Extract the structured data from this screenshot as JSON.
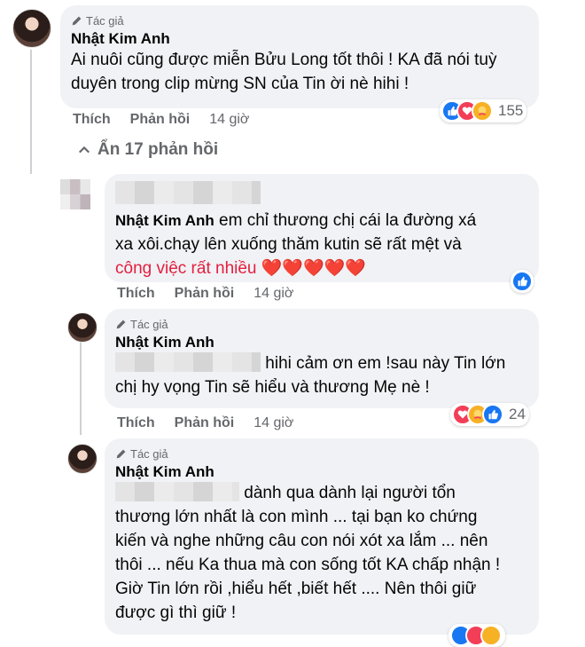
{
  "comment": {
    "author_tag": "Tác giả",
    "name": "Nhật Kim Anh",
    "text_line1": "Ai nuôi cũng được miễn Bửu Long tốt thôi ! KA đã nói tuỳ",
    "text_line2": "duyên trong clip mừng SN của Tin ời nè hihi !",
    "actions": {
      "like": "Thích",
      "reply": "Phản hồi",
      "time": "14 giờ"
    },
    "reaction_count": "155"
  },
  "hidden_replies": {
    "label": "Ẩn 17 phản hồi"
  },
  "reply1": {
    "name": "Nhật Kim Anh",
    "text_inline": "em chỉ thương chị cái la đường xá",
    "text_line2": "xa xôi.chạy lên xuống thăm kutin sẽ rất mệt và",
    "text_line3": "công việc rất nhiều ❤️❤️❤️❤️❤️",
    "actions": {
      "like": "Thích",
      "reply": "Phản hồi",
      "time": "14 giờ"
    }
  },
  "reply2": {
    "author_tag": "Tác giả",
    "name": "Nhật Kim Anh",
    "text_inline": "hihi cảm ơn em !sau này Tin lớn",
    "text_line2": "chị hy vọng Tin sẽ hiểu và thương Mẹ nè !",
    "actions": {
      "like": "Thích",
      "reply": "Phản hồi",
      "time": "14 giờ"
    },
    "reaction_count": "24"
  },
  "reply3": {
    "author_tag": "Tác giả",
    "name": "Nhật Kim Anh",
    "text_inline": "dành qua dành lại người tổn",
    "text_line2": "thương lớn nhất là con mình ... tại bạn ko chứng",
    "text_line3": "kiến và nghe những câu con nói xót xa lắm ... nên",
    "text_line4": "thôi ... nếu Ka thua mà con sống tốt KA chấp nhận !",
    "text_line5": "Giờ Tin lớn rồi ,hiểu hết ,biết hết .... Nên thôi giữ",
    "text_line6": "được gì thì giữ !"
  },
  "colors": {
    "like": "#1877f2",
    "love": "#f33e58",
    "care": "#f7b125",
    "secondary_text": "#65676b",
    "bubble": "#f0f2f5"
  }
}
